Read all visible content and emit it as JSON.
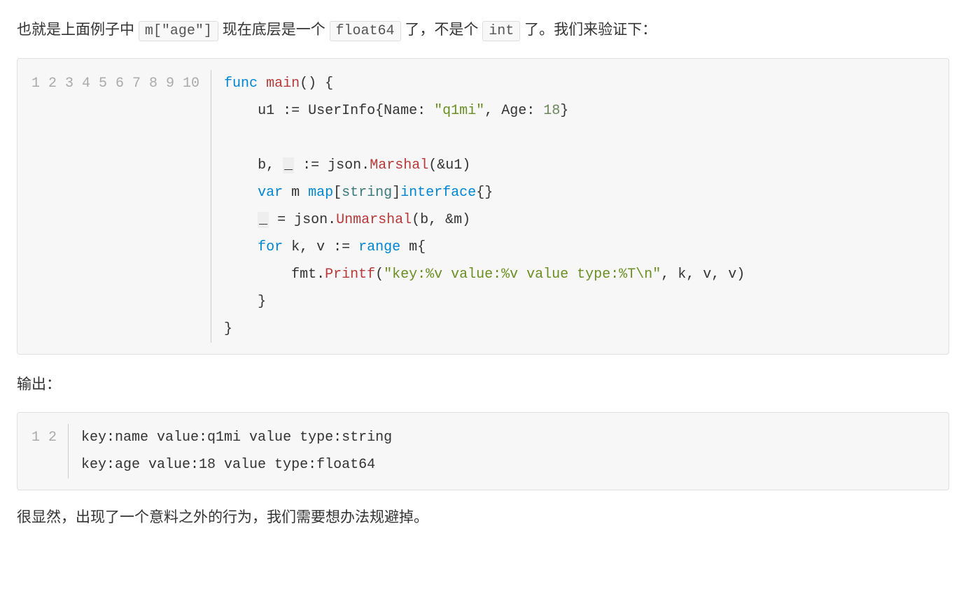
{
  "para1": {
    "t1": "也就是上面例子中 ",
    "code1": "m[\"age\"]",
    "t2": " 现在底层是一个 ",
    "code2": "float64",
    "t3": " 了，不是个 ",
    "code3": "int",
    "t4": " 了。我们来验证下："
  },
  "code1": {
    "line_numbers": "1\n2\n3\n4\n5\n6\n7\n8\n9\n10",
    "tokens": {
      "l1_func": "func",
      "l1_main": "main",
      "l1_paren": "()",
      "l1_brace": " {",
      "l2_indent": "    ",
      "l2_u1": "u1 ",
      "l2_assign": ":=",
      "l2_sp": " ",
      "l2_userinfo": "UserInfo",
      "l2_lbrace": "{",
      "l2_name": "Name",
      "l2_colon1": ": ",
      "l2_str": "\"q1mi\"",
      "l2_comma": ", ",
      "l2_age": "Age",
      "l2_colon2": ": ",
      "l2_num": "18",
      "l2_rbrace": "}",
      "l4_indent": "    ",
      "l4_b": "b",
      "l4_comma": ", ",
      "l4_blank": "_",
      "l4_sp": " ",
      "l4_assign": ":=",
      "l4_sp2": " ",
      "l4_json": "json",
      "l4_dot": ".",
      "l4_marshal": "Marshal",
      "l4_args": "(&u1)",
      "l5_indent": "    ",
      "l5_var": "var",
      "l5_m": " m ",
      "l5_map": "map",
      "l5_lbr": "[",
      "l5_string": "string",
      "l5_rbr": "]",
      "l5_interface": "interface",
      "l5_braces": "{}",
      "l6_indent": "    ",
      "l6_blank": "_",
      "l6_eq": " = ",
      "l6_json": "json",
      "l6_dot": ".",
      "l6_unmarshal": "Unmarshal",
      "l6_args": "(b, &m)",
      "l7_indent": "    ",
      "l7_for": "for",
      "l7_kv": " k, v ",
      "l7_assign": ":=",
      "l7_sp": " ",
      "l7_range": "range",
      "l7_m": " m{",
      "l8_indent": "        ",
      "l8_fmt": "fmt",
      "l8_dot": ".",
      "l8_printf": "Printf",
      "l8_lp": "(",
      "l8_str": "\"key:%v value:%v value type:%T\\n\"",
      "l8_args": ", k, v, v)",
      "l9_indent": "    ",
      "l9_brace": "}",
      "l10_brace": "}"
    }
  },
  "output_label": "输出：",
  "code2": {
    "line_numbers": "1\n2",
    "content": "key:name value:q1mi value type:string\nkey:age value:18 value type:float64"
  },
  "para2": "很显然，出现了一个意料之外的行为，我们需要想办法规避掉。"
}
